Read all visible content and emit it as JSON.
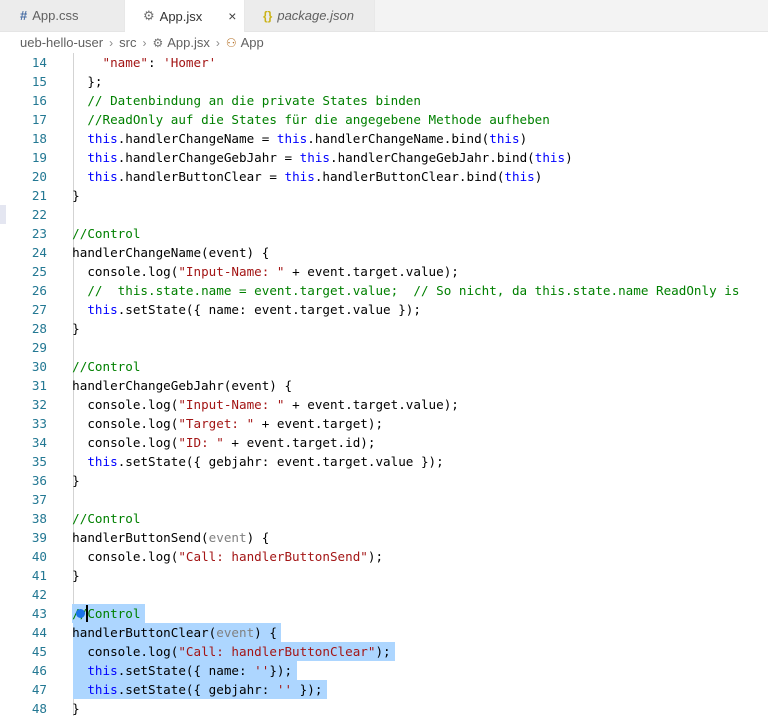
{
  "tabs": [
    {
      "icon": "#",
      "label": "App.css",
      "active": false,
      "italic": false
    },
    {
      "icon": "⚙",
      "label": "App.jsx",
      "active": true,
      "italic": false,
      "close": "×"
    },
    {
      "icon": "{}",
      "label": "package.json",
      "active": false,
      "italic": true
    }
  ],
  "breadcrumb": {
    "items": [
      "ueb-hello-user",
      "src",
      "App.jsx",
      "App"
    ],
    "separator": "›"
  },
  "editor": {
    "lines": [
      {
        "n": "14",
        "tokens": [
          {
            "t": "      ",
            "c": "pl"
          },
          {
            "t": "\"name\"",
            "c": "st"
          },
          {
            "t": ": ",
            "c": "pl"
          },
          {
            "t": "'Homer'",
            "c": "st"
          }
        ]
      },
      {
        "n": "15",
        "tokens": [
          {
            "t": "    };",
            "c": "pl"
          }
        ]
      },
      {
        "n": "16",
        "tokens": [
          {
            "t": "    ",
            "c": "pl"
          },
          {
            "t": "// Datenbindung an die private States binden",
            "c": "cm"
          }
        ]
      },
      {
        "n": "17",
        "tokens": [
          {
            "t": "    ",
            "c": "pl"
          },
          {
            "t": "//ReadOnly auf die States für die angegebene Methode aufheben",
            "c": "cm"
          }
        ]
      },
      {
        "n": "18",
        "tokens": [
          {
            "t": "    ",
            "c": "pl"
          },
          {
            "t": "this",
            "c": "kw"
          },
          {
            "t": ".handlerChangeName = ",
            "c": "pl"
          },
          {
            "t": "this",
            "c": "kw"
          },
          {
            "t": ".handlerChangeName.bind(",
            "c": "pl"
          },
          {
            "t": "this",
            "c": "kw"
          },
          {
            "t": ")",
            "c": "pl"
          }
        ]
      },
      {
        "n": "19",
        "tokens": [
          {
            "t": "    ",
            "c": "pl"
          },
          {
            "t": "this",
            "c": "kw"
          },
          {
            "t": ".handlerChangeGebJahr = ",
            "c": "pl"
          },
          {
            "t": "this",
            "c": "kw"
          },
          {
            "t": ".handlerChangeGebJahr.bind(",
            "c": "pl"
          },
          {
            "t": "this",
            "c": "kw"
          },
          {
            "t": ")",
            "c": "pl"
          }
        ]
      },
      {
        "n": "20",
        "tokens": [
          {
            "t": "    ",
            "c": "pl"
          },
          {
            "t": "this",
            "c": "kw"
          },
          {
            "t": ".handlerButtonClear = ",
            "c": "pl"
          },
          {
            "t": "this",
            "c": "kw"
          },
          {
            "t": ".handlerButtonClear.bind(",
            "c": "pl"
          },
          {
            "t": "this",
            "c": "kw"
          },
          {
            "t": ")",
            "c": "pl"
          }
        ]
      },
      {
        "n": "21",
        "tokens": [
          {
            "t": "  }",
            "c": "pl"
          }
        ]
      },
      {
        "n": "22",
        "tokens": []
      },
      {
        "n": "23",
        "tokens": [
          {
            "t": "  ",
            "c": "pl"
          },
          {
            "t": "//Control",
            "c": "cm"
          }
        ]
      },
      {
        "n": "24",
        "tokens": [
          {
            "t": "  handlerChangeName(event) {",
            "c": "pl"
          }
        ]
      },
      {
        "n": "25",
        "tokens": [
          {
            "t": "    console.log(",
            "c": "pl"
          },
          {
            "t": "\"Input-Name: \"",
            "c": "st"
          },
          {
            "t": " + event.target.value);",
            "c": "pl"
          }
        ]
      },
      {
        "n": "26",
        "tokens": [
          {
            "t": "    ",
            "c": "pl"
          },
          {
            "t": "//  this.state.name = event.target.value;  // So nicht, da this.state.name ReadOnly is",
            "c": "cm"
          }
        ]
      },
      {
        "n": "27",
        "tokens": [
          {
            "t": "    ",
            "c": "pl"
          },
          {
            "t": "this",
            "c": "kw"
          },
          {
            "t": ".setState({ name: event.target.value });",
            "c": "pl"
          }
        ]
      },
      {
        "n": "28",
        "tokens": [
          {
            "t": "  }",
            "c": "pl"
          }
        ]
      },
      {
        "n": "29",
        "tokens": []
      },
      {
        "n": "30",
        "tokens": [
          {
            "t": "  ",
            "c": "pl"
          },
          {
            "t": "//Control",
            "c": "cm"
          }
        ]
      },
      {
        "n": "31",
        "tokens": [
          {
            "t": "  handlerChangeGebJahr(event) {",
            "c": "pl"
          }
        ]
      },
      {
        "n": "32",
        "tokens": [
          {
            "t": "    console.log(",
            "c": "pl"
          },
          {
            "t": "\"Input-Name: \"",
            "c": "st"
          },
          {
            "t": " + event.target.value);",
            "c": "pl"
          }
        ]
      },
      {
        "n": "33",
        "tokens": [
          {
            "t": "    console.log(",
            "c": "pl"
          },
          {
            "t": "\"Target: \"",
            "c": "st"
          },
          {
            "t": " + event.target);",
            "c": "pl"
          }
        ]
      },
      {
        "n": "34",
        "tokens": [
          {
            "t": "    console.log(",
            "c": "pl"
          },
          {
            "t": "\"ID: \"",
            "c": "st"
          },
          {
            "t": " + event.target.id);",
            "c": "pl"
          }
        ]
      },
      {
        "n": "35",
        "tokens": [
          {
            "t": "    ",
            "c": "pl"
          },
          {
            "t": "this",
            "c": "kw"
          },
          {
            "t": ".setState({ gebjahr: event.target.value });",
            "c": "pl"
          }
        ]
      },
      {
        "n": "36",
        "tokens": [
          {
            "t": "  }",
            "c": "pl"
          }
        ]
      },
      {
        "n": "37",
        "tokens": []
      },
      {
        "n": "38",
        "tokens": [
          {
            "t": "  ",
            "c": "pl"
          },
          {
            "t": "//Control",
            "c": "cm"
          }
        ]
      },
      {
        "n": "39",
        "tokens": [
          {
            "t": "  handlerButtonSend(",
            "c": "pl"
          },
          {
            "t": "event",
            "c": "prm"
          },
          {
            "t": ") {",
            "c": "pl"
          }
        ]
      },
      {
        "n": "40",
        "tokens": [
          {
            "t": "    console.log(",
            "c": "pl"
          },
          {
            "t": "\"Call: handlerButtonSend\"",
            "c": "st"
          },
          {
            "t": ");",
            "c": "pl"
          }
        ]
      },
      {
        "n": "41",
        "tokens": [
          {
            "t": "  }",
            "c": "pl"
          }
        ]
      },
      {
        "n": "42",
        "tokens": []
      },
      {
        "n": "43",
        "tokens": [
          {
            "t": "  ",
            "c": "pl"
          },
          {
            "t": "//Control",
            "c": "cm"
          }
        ]
      },
      {
        "n": "44",
        "tokens": [
          {
            "t": "  handlerButtonClear(",
            "c": "pl"
          },
          {
            "t": "event",
            "c": "prm"
          },
          {
            "t": ") {",
            "c": "pl"
          }
        ]
      },
      {
        "n": "45",
        "tokens": [
          {
            "t": "    console.log(",
            "c": "pl"
          },
          {
            "t": "\"Call: handlerButtonClear\"",
            "c": "st"
          },
          {
            "t": ");",
            "c": "pl"
          }
        ]
      },
      {
        "n": "46",
        "tokens": [
          {
            "t": "    ",
            "c": "pl"
          },
          {
            "t": "this",
            "c": "kw"
          },
          {
            "t": ".setState({ name: ",
            "c": "pl"
          },
          {
            "t": "''",
            "c": "st"
          },
          {
            "t": "});",
            "c": "pl"
          }
        ]
      },
      {
        "n": "47",
        "tokens": [
          {
            "t": "    ",
            "c": "pl"
          },
          {
            "t": "this",
            "c": "kw"
          },
          {
            "t": ".setState({ gebjahr: ",
            "c": "pl"
          },
          {
            "t": "''",
            "c": "st"
          },
          {
            "t": " });",
            "c": "pl"
          }
        ]
      },
      {
        "n": "48",
        "tokens": [
          {
            "t": "  }",
            "c": "pl"
          }
        ]
      }
    ],
    "selected_lines": [
      "43",
      "44",
      "45",
      "46",
      "47"
    ]
  },
  "colors": {
    "keyword": "#0000ff",
    "comment": "#008000",
    "string": "#a31515",
    "line_number": "#237893",
    "selection": "#add6ff"
  }
}
